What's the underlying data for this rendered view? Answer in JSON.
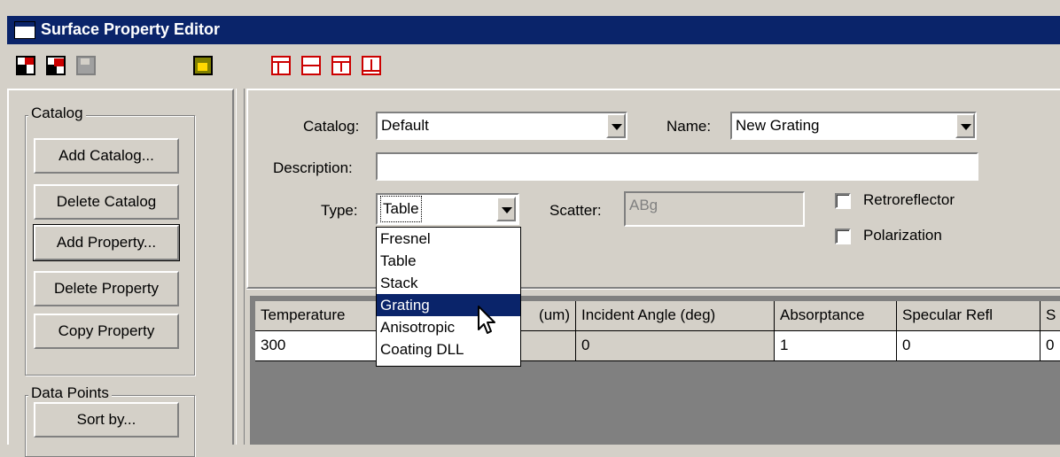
{
  "window": {
    "title": "Surface Property Editor"
  },
  "toolbar": {
    "icons": [
      "save-as-icon",
      "delete-icon",
      "disk-icon",
      "unlock-icon",
      "layout-1-icon",
      "layout-2-icon",
      "insert-row-icon",
      "append-row-icon"
    ]
  },
  "catalog_group": {
    "title": "Catalog",
    "add_catalog": "Add Catalog...",
    "delete_catalog": "Delete Catalog",
    "add_property": "Add Property...",
    "delete_property": "Delete Property",
    "copy_property": "Copy Property"
  },
  "data_points_group": {
    "title": "Data Points",
    "sort_by": "Sort by..."
  },
  "form": {
    "catalog_label": "Catalog:",
    "catalog_value": "Default",
    "name_label": "Name:",
    "name_value": "New Grating",
    "description_label": "Description:",
    "description_value": "",
    "type_label": "Type:",
    "type_value": "Table",
    "scatter_label": "Scatter:",
    "scatter_value": "ABg",
    "retroreflector_label": "Retroreflector",
    "polarization_label": "Polarization"
  },
  "type_dropdown": {
    "options": [
      "Fresnel",
      "Table",
      "Stack",
      "Grating",
      "Anisotropic",
      "Coating DLL"
    ],
    "highlighted": "Grating"
  },
  "table": {
    "headers": [
      "Temperature",
      "(um)",
      "Incident Angle (deg)",
      "Absorptance",
      "Specular Refl",
      "S"
    ],
    "row": [
      "300",
      "",
      "0",
      "1",
      "0",
      "0"
    ]
  }
}
